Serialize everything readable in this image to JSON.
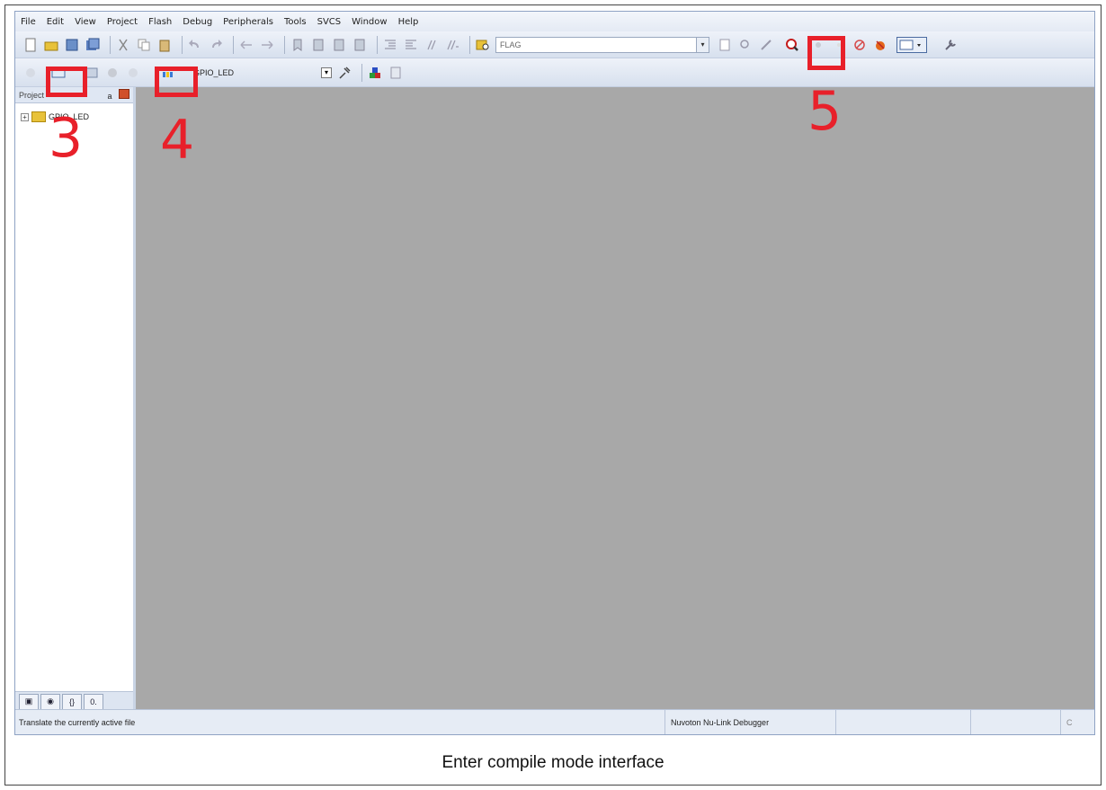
{
  "menu": [
    "File",
    "Edit",
    "View",
    "Project",
    "Flash",
    "Debug",
    "Peripherals",
    "Tools",
    "SVCS",
    "Window",
    "Help"
  ],
  "toolbar": {
    "find_combo_value": "FLAG",
    "target_combo_value": "GPIO_LED"
  },
  "project_panel": {
    "title": "Project",
    "pin_glyph": "a",
    "tree": [
      {
        "label": "GPIO_LED",
        "expander": "+"
      }
    ],
    "tabs": [
      "▣",
      "◉",
      "{}",
      "0."
    ]
  },
  "status": {
    "message": "Translate the currently active file",
    "debugger": "Nuvoton Nu-Link Debugger",
    "extra": "C"
  },
  "annotations": {
    "three": "3",
    "four": "4",
    "five": "5",
    "color": "#e8202a"
  },
  "caption": "Enter compile mode interface"
}
